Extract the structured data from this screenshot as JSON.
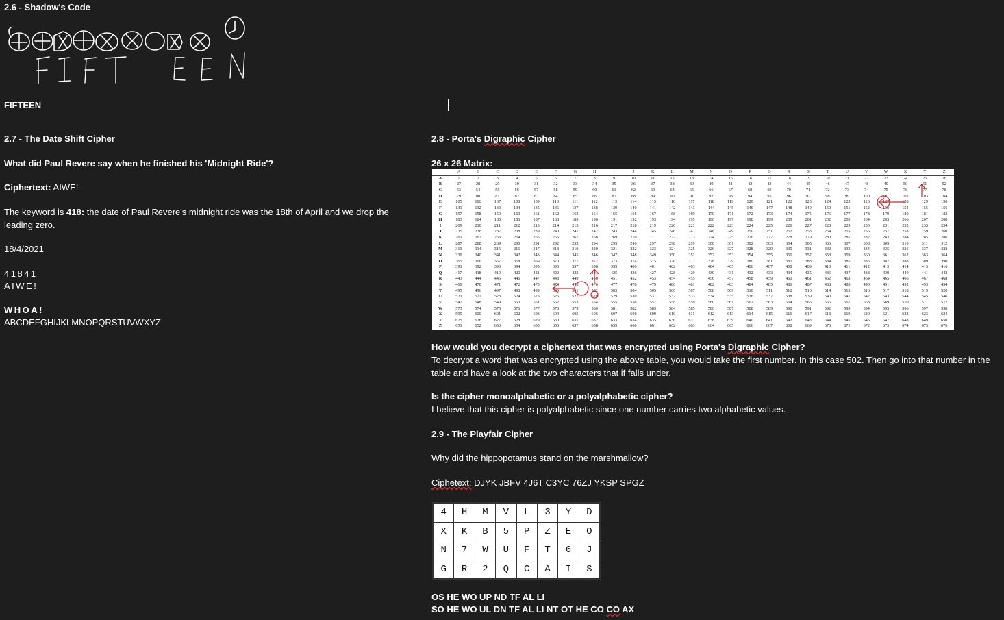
{
  "shadow": {
    "heading": "2.6 - Shadow's Code",
    "answer": "FIFTEEN"
  },
  "date_shift": {
    "heading": "2.7 - The Date Shift Cipher",
    "question": "What did Paul Revere say when he finished his 'Midnight Ride'?",
    "ciphertext_label": "Ciphertext:",
    "ciphertext_value": " AIWE!",
    "keyword_pre": "The keyword is ",
    "keyword_bold": "418:",
    "keyword_post": " the date of Paul Revere's midnight ride was the 18th of April and we drop the leading zero.",
    "date": "18/4/2021",
    "key_row": "41841",
    "cipher_row": "AIWE!",
    "plaintext": "WHOA!",
    "alphabet": "ABCDEFGHIJKLMNOPQRSTUVWXYZ"
  },
  "porta": {
    "heading_pre": "2.8 - Porta's ",
    "heading_word": "Digraphic",
    "heading_post": " Cipher",
    "matrix_label": "26 x 26 Matrix:",
    "matrix_letters": [
      "A",
      "B",
      "C",
      "D",
      "E",
      "F",
      "G",
      "H",
      "I",
      "J",
      "K",
      "L",
      "M",
      "N",
      "O",
      "P",
      "Q",
      "R",
      "S",
      "T",
      "U",
      "V",
      "W",
      "X",
      "Y",
      "Z"
    ],
    "q1_pre": "How would you decrypt a ciphertext that was encrypted using Porta's ",
    "q1_word": "Digraphic",
    "q1_post": " Cipher?",
    "a1": "To decrypt a word that was encrypted using the above table, you would take the first number. In this case 502. Then go into that number in the table and have a look at the two characters that if falls under.",
    "q2": "Is the cipher monoalphabetic or a polyalphabetic cipher?",
    "a2": "I believe that this cipher is polyalphabetic since one number carries two alphabetic values."
  },
  "playfair": {
    "heading": "2.9 - The Playfair Cipher",
    "question": "Why did the hippopotamus stand on the marshmallow?",
    "ciphertext_label": "Ciphetext:",
    "ciphertext_value": " DJYK JBFV 4J6T C3YC 76ZJ YKSP SPGZ",
    "grid": [
      [
        "4",
        "H",
        "M",
        "V",
        "L",
        "3",
        "Y",
        "D"
      ],
      [
        "X",
        "K",
        "B",
        "5",
        "P",
        "Z",
        "E",
        "O"
      ],
      [
        "N",
        "7",
        "W",
        "U",
        "F",
        "T",
        "6",
        "J"
      ],
      [
        "G",
        "R",
        "2",
        "Q",
        "C",
        "A",
        "I",
        "S"
      ]
    ],
    "line1": "OS HE WO UP ND TF AL LI",
    "line2_pre": "SO HE WO UL DN TF AL LI NT OT HE CO ",
    "line2_word": "CO",
    "line2_post": " AX"
  }
}
